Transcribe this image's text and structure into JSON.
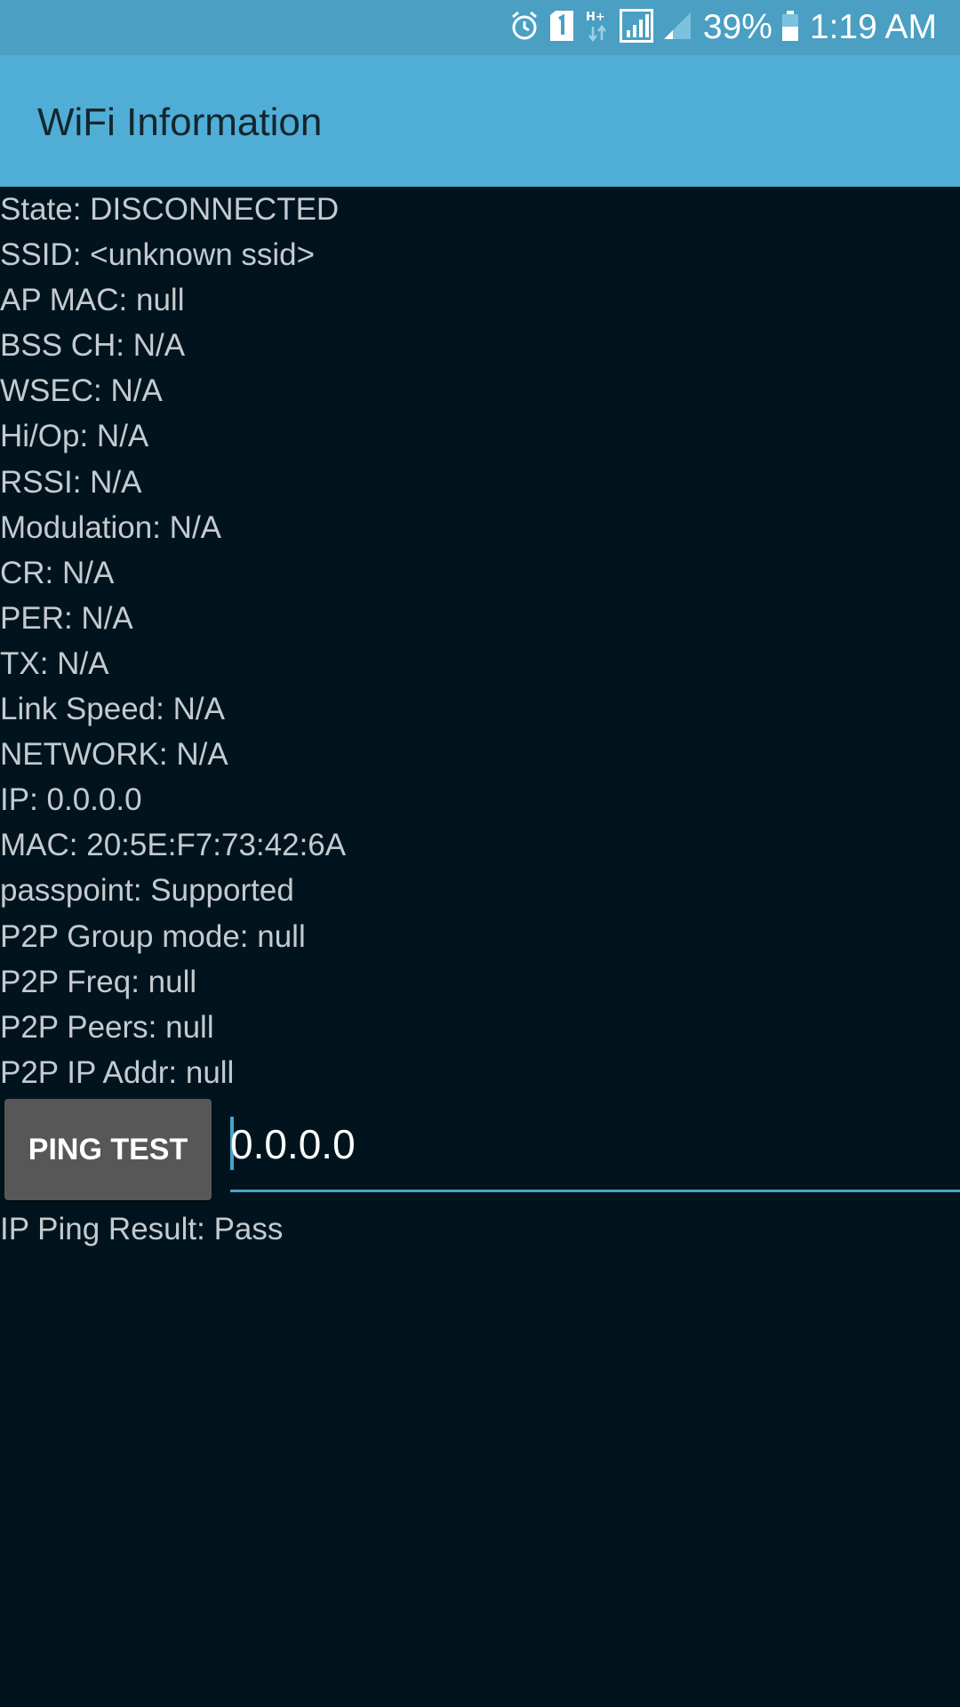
{
  "status_bar": {
    "icons": [
      "alarm-icon",
      "sim-1-icon",
      "hplus-data-icon",
      "signal-full-icon",
      "signal-weak-icon",
      "battery-icon"
    ],
    "battery": "39%",
    "time": "1:19 AM"
  },
  "app_bar": {
    "title": "WiFi Information"
  },
  "info_lines": [
    "State: DISCONNECTED",
    "SSID: <unknown ssid>",
    "AP MAC: null",
    "BSS CH: N/A",
    "WSEC: N/A",
    "Hi/Op: N/A",
    "RSSI: N/A",
    "Modulation: N/A",
    "CR: N/A",
    "PER: N/A",
    "TX: N/A",
    "Link Speed: N/A",
    "NETWORK: N/A",
    "IP: 0.0.0.0",
    "MAC: 20:5E:F7:73:42:6A",
    "passpoint: Supported",
    "P2P Group mode: null",
    "P2P Freq: null",
    "P2P Peers: null",
    "P2P IP Addr: null"
  ],
  "ping": {
    "button_label": "PING TEST",
    "input_value": "0.0.0.0",
    "result": "IP Ping Result: Pass"
  },
  "colors": {
    "status_bar": "#4a9fc3",
    "app_bar": "#50aed6",
    "background": "#01141d",
    "text": "#c4cbcf",
    "accent": "#47a3cd",
    "button": "#575757"
  }
}
